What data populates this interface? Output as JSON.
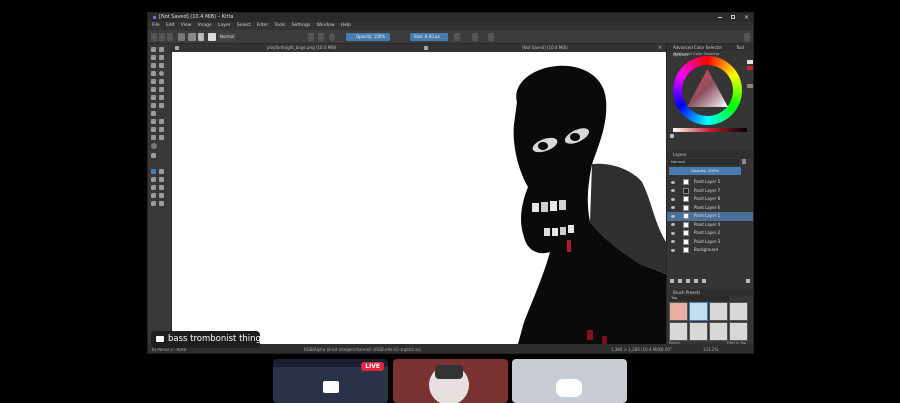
{
  "app": {
    "title": "[Not Saved] (10.4 MiB) – Krita",
    "menu": [
      "File",
      "Edit",
      "View",
      "Image",
      "Layer",
      "Select",
      "Filter",
      "Tools",
      "Settings",
      "Window",
      "Help"
    ]
  },
  "toolbar": {
    "blend_mode": "Normal",
    "opacity_label": "Opacity: 100%",
    "size_label": "Size: 8.00 px"
  },
  "document_tabs": [
    "playfordnight_bage.png (10.4 MiB)",
    "[Not Saved] (10.4 MiB)"
  ],
  "tool_hints": [
    "Automatic Mask Paint Tool  L+R",
    "Smart Patch Tool"
  ],
  "status": {
    "left": "b) Pencil 2 - Krita",
    "color_info": "RGB/Alpha (8-bit integer/channel)  sRGB-elle-V2-srgbtrc.icc",
    "dims": "1,380 × 1,280 (10.4 MiB)",
    "rotation": "0.00°",
    "zoom": "131.2%"
  },
  "dock": {
    "color_selector_tabs": [
      "Advanced Color Selector",
      "Tool Options"
    ],
    "color_selector_title": "Advanced Color Selector",
    "layers_title": "Layers",
    "layer_mode": "Normal",
    "layer_opacity": "Opacity: 100%",
    "layers": [
      "Paint Layer 5",
      "Paint Layer 7",
      "Paint Layer 8",
      "Paint Layer 6",
      "Paint Layer 1",
      "Paint Layer 4",
      "Paint Layer 2",
      "Paint Layer 3",
      "Background"
    ],
    "brush_presets_title": "Brush Presets",
    "brush_tag": "Tag",
    "brush_search": "Search",
    "filter_in_tag": "Filter in Tag"
  },
  "caption": "bass trombonist thing",
  "live_badge": "LIVE",
  "colors": {
    "accent": "#4a7bb0",
    "live": "#e0253d",
    "discord": "#5865f2"
  }
}
